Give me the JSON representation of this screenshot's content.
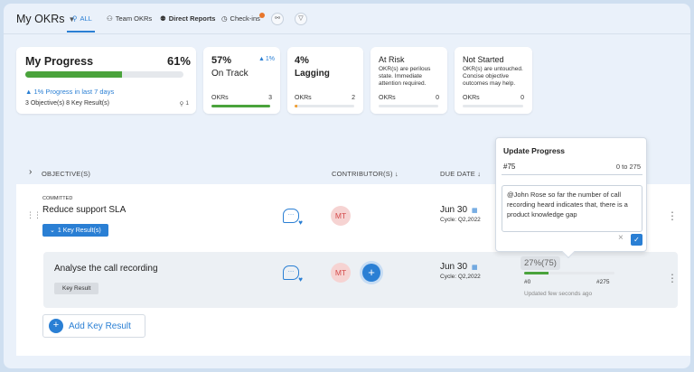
{
  "nav": {
    "title": "My OKRs",
    "tabs": [
      {
        "label": "ALL"
      },
      {
        "label": "Team OKRs"
      },
      {
        "label": "Direct Reports"
      },
      {
        "label": "Check-ins"
      }
    ]
  },
  "progress_card": {
    "title": "My Progress",
    "percent_label": "61%",
    "percent": 61,
    "change_text": "1% Progress in last 7 days",
    "summary": "3 Objective(s) 8 Key Result(s)",
    "people_count": "1"
  },
  "stat_cards": [
    {
      "value": "57%",
      "label": "On Track",
      "change": "1%",
      "footer_label": "OKRs",
      "count": "3",
      "fill": 1.0,
      "color": "#4aa33c"
    },
    {
      "value": "4%",
      "label": "Lagging",
      "footer_label": "OKRs",
      "count": "2",
      "fill": 0.04,
      "color": "#f0a23b"
    },
    {
      "value": "At Risk",
      "desc": "OKR(s) are perilous state. Immediate attention required.",
      "footer_label": "OKRs",
      "count": "0",
      "fill": 0
    },
    {
      "value": "Not Started",
      "desc": "OKR(s) are untouched. Concise objective outcomes may help.",
      "footer_label": "OKRs",
      "count": "0",
      "fill": 0
    }
  ],
  "table": {
    "col_objectives": "OBJECTIVE(S)",
    "col_contributors": "CONTRIBUTOR(S) ↓",
    "col_due": "DUE DATE ↓"
  },
  "objective": {
    "status": "COMMITTED",
    "title": "Reduce support SLA",
    "kr_chip": "1 Key Result(s)",
    "avatar": "MT",
    "due": "Jun 30",
    "cycle": "Cycle: Q2,2022"
  },
  "key_result": {
    "title": "Analyse the call recording",
    "tag": "Key Result",
    "avatar": "MT",
    "due": "Jun 30",
    "cycle": "Cycle: Q2,2022",
    "progress_label": "27%(75)",
    "progress": 0.27,
    "min_label": "#0",
    "max_label": "#275",
    "updated": "Updated few seconds ago"
  },
  "add_kr": "Add Key Result",
  "popover": {
    "title": "Update Progress",
    "value": "#75",
    "range": "0 to 275",
    "comment": "@John Rose so far the number of call recording heard indicates that, there is a product knowledge gap"
  },
  "colors": {
    "accent": "#2a7fd4",
    "green": "#4aa33c",
    "orange": "#f0a23b"
  }
}
